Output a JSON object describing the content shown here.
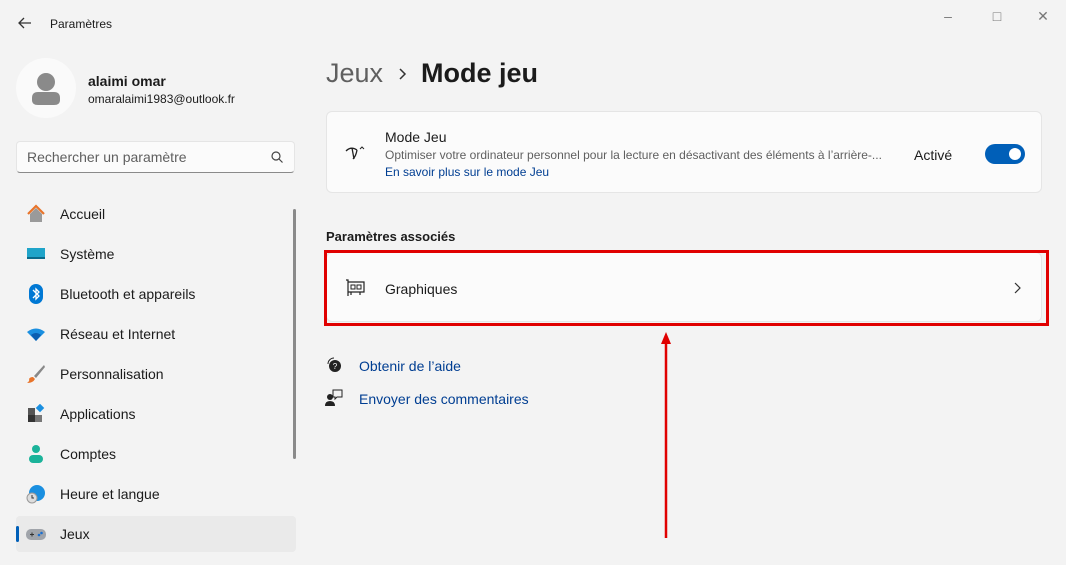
{
  "window": {
    "title": "Paramètres"
  },
  "user": {
    "name": "alaimi omar",
    "email": "omaralaimi1983@outlook.fr"
  },
  "search": {
    "placeholder": "Rechercher un paramètre"
  },
  "sidebar": {
    "items": [
      {
        "label": "Accueil",
        "icon": "home-icon"
      },
      {
        "label": "Système",
        "icon": "display-icon"
      },
      {
        "label": "Bluetooth et appareils",
        "icon": "bluetooth-icon"
      },
      {
        "label": "Réseau et Internet",
        "icon": "wifi-icon"
      },
      {
        "label": "Personnalisation",
        "icon": "brush-icon"
      },
      {
        "label": "Applications",
        "icon": "apps-icon"
      },
      {
        "label": "Comptes",
        "icon": "account-icon"
      },
      {
        "label": "Heure et langue",
        "icon": "globe-clock-icon"
      },
      {
        "label": "Jeux",
        "icon": "gamepad-icon",
        "selected": true
      }
    ]
  },
  "breadcrumb": {
    "parent": "Jeux",
    "current": "Mode jeu"
  },
  "mode_card": {
    "title": "Mode Jeu",
    "description": "Optimiser votre ordinateur personnel pour la lecture en désactivant des éléments à l’arrière-...",
    "link": "En savoir plus sur le mode Jeu",
    "status": "Activé",
    "toggle_on": true
  },
  "related": {
    "heading": "Paramètres associés",
    "items": [
      {
        "label": "Graphiques",
        "icon": "graphics-card-icon"
      }
    ]
  },
  "help": {
    "get_help": "Obtenir de l’aide",
    "feedback": "Envoyer des commentaires"
  },
  "colors": {
    "accent": "#005fb8",
    "annotation": "#e00000"
  }
}
